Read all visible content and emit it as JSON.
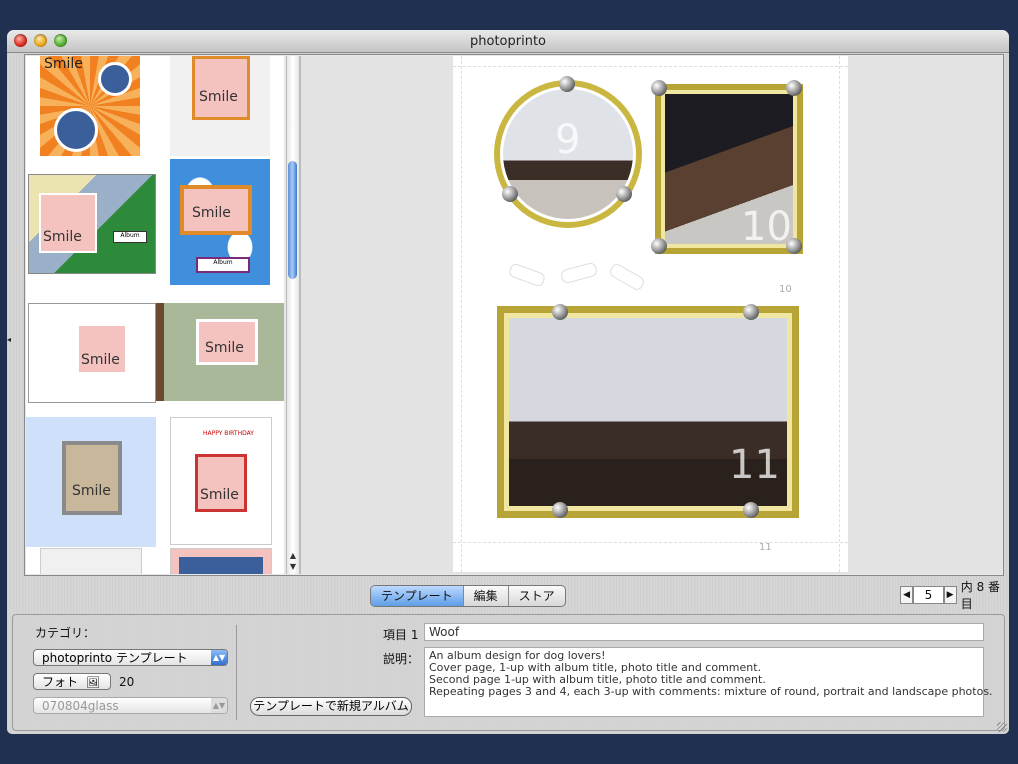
{
  "window": {
    "title": "photoprinto"
  },
  "thumbnails": [
    {
      "label": "Smile"
    },
    {
      "label": "Smile"
    },
    {
      "label": "Smile",
      "caption": "Album"
    },
    {
      "label": "Smile",
      "caption": "Album"
    },
    {
      "label": "Smile"
    },
    {
      "label": "Smile"
    },
    {
      "label": "Smile"
    },
    {
      "label": "Smile",
      "sublabel": "HAPPY BIRTHDAY"
    }
  ],
  "page": {
    "photos": [
      {
        "num": "9",
        "shape": "round"
      },
      {
        "num": "10",
        "shape": "portrait"
      },
      {
        "num": "11",
        "shape": "landscape"
      }
    ],
    "page_numbers": [
      "10",
      "11"
    ]
  },
  "tabs": [
    {
      "label": "テンプレート",
      "active": true
    },
    {
      "label": "編集",
      "active": false
    },
    {
      "label": "ストア",
      "active": false
    }
  ],
  "pager": {
    "value": "5",
    "suffix": "内 8 番目"
  },
  "panel": {
    "category_label": "カテゴリ：",
    "category_value": "photoprinto テンプレート",
    "photo_type": "フォト",
    "photo_count": "20",
    "template_name": "070804glass",
    "new_album_button": "テンプレートで新規アルバム",
    "item_label": "項目 1",
    "item_value": "Woof",
    "desc_label": "説明：",
    "description": [
      "An album design for dog lovers!",
      "Cover page, 1-up with album title, photo title and comment.",
      "Second page 1-up with album title, photo title and comment.",
      "Repeating pages 3 and 4, each 3-up with comments: mixture of round, portrait and landscape photos."
    ]
  },
  "colors": {
    "accent": "#5f9ee6",
    "frame_gold": "#b7a437",
    "background": "#1f3050"
  }
}
